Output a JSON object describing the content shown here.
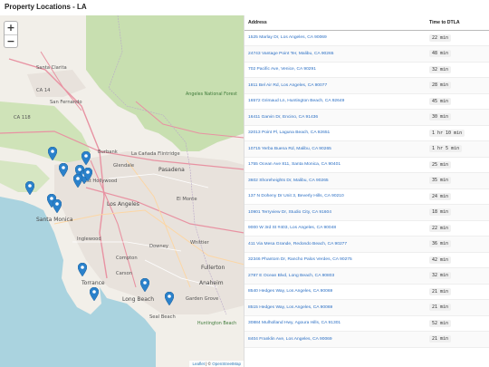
{
  "page": {
    "title": "Property Locations - LA"
  },
  "map": {
    "zoom_in": "+",
    "zoom_out": "−",
    "attribution": {
      "leaflet": "Leaflet",
      "separator": " | © ",
      "osm": "OpenStreetMap"
    },
    "labels": {
      "santa_clarita": "Santa Clarita",
      "burbank": "Burbank",
      "pasadena": "Pasadena",
      "glendale": "Glendale",
      "los_angeles": "Los Angeles",
      "santa_monica": "Santa Monica",
      "inglewood": "Inglewood",
      "compton": "Compton",
      "torrance": "Torrance",
      "long_beach": "Long Beach",
      "downey": "Downey",
      "fullerton": "Fullerton",
      "anaheim": "Anaheim",
      "garden_grove": "Garden Grove",
      "huntington_beach": "Huntington Beach",
      "el_monte": "El Monte",
      "whittier": "Whittier",
      "angeles_forest": "Angeles National Forest",
      "ca14": "CA 14",
      "ca118": "CA 118",
      "seal_beach": "Seal Beach",
      "carson": "Carson",
      "west_hollywood": "West Hollywood",
      "la_canada": "La Cañada Flintridge",
      "san_fernando": "San Fernando"
    }
  },
  "table": {
    "headers": {
      "address": "Address",
      "time": "Time to DTLA"
    },
    "rows": [
      {
        "address": "1525 Marlay Dr, Los Angeles, CA 90069",
        "time": "22 min"
      },
      {
        "address": "24743 Vantage Point Ter, Malibu, CA 90265",
        "time": "48 min"
      },
      {
        "address": "702 Pacific Ave, Venice, CA 90291",
        "time": "32 min"
      },
      {
        "address": "1811 Bel Air Rd, Los Angeles, CA 90077",
        "time": "28 min"
      },
      {
        "address": "16572 Grimaud Ln, Huntington Beach, CA 92649",
        "time": "45 min"
      },
      {
        "address": "16411 Garvin Dr, Encino, CA 91436",
        "time": "30 min"
      },
      {
        "address": "32013 Point Pl, Laguna Beach, CA 92651",
        "time": "1 hr 10 min"
      },
      {
        "address": "10715 Yerba Buena Rd, Malibu, CA 90265",
        "time": "1 hr 5 min"
      },
      {
        "address": "1755 Ocean Ave 811, Santa Monica, CA 90401",
        "time": "25 min"
      },
      {
        "address": "3602 Shoreheights Dr, Malibu, CA 90265",
        "time": "35 min"
      },
      {
        "address": "137 N Doheny Dr Unit 3, Beverly Hills, CA 90210",
        "time": "24 min"
      },
      {
        "address": "10901 Terryview Dr, Studio City, CA 91604",
        "time": "18 min"
      },
      {
        "address": "9000 W 3rd St #403, Los Angeles, CA 90048",
        "time": "22 min"
      },
      {
        "address": "411 Via Mesa Grande, Redondo Beach, CA 90277",
        "time": "36 min"
      },
      {
        "address": "32346 Phantom Dr, Rancho Palos Verdes, CA 90275",
        "time": "42 min"
      },
      {
        "address": "2787 E Ocean Blvd, Long Beach, CA 90803",
        "time": "32 min"
      },
      {
        "address": "8540 Hedges Way, Los Angeles, CA 90069",
        "time": "21 min"
      },
      {
        "address": "8515 Hedges Way, Los Angeles, CA 90069",
        "time": "21 min"
      },
      {
        "address": "30884 Mulholland Hwy, Agoura Hills, CA 91301",
        "time": "52 min"
      },
      {
        "address": "8404 Franklin Ave, Los Angeles, CA 90069",
        "time": "21 min"
      }
    ]
  }
}
